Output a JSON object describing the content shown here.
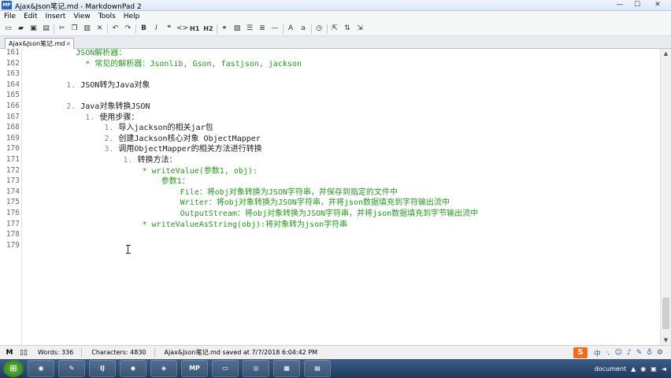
{
  "window": {
    "title": "Ajax&Json笔记.md - MarkdownPad 2",
    "app_icon_text": "MP",
    "minimize": "—",
    "maximize": "☐",
    "close": "✕"
  },
  "menu": [
    "File",
    "Edit",
    "Insert",
    "View",
    "Tools",
    "Help"
  ],
  "toolbar": {
    "h1_label": "H1",
    "h2_label": "H2"
  },
  "tab": {
    "label": "Ajax&Json笔记.md",
    "close": "×"
  },
  "editor": {
    "line_numbers": [
      "161",
      "162",
      "163",
      "164",
      "165",
      "166",
      "167",
      "168",
      "169",
      "170",
      "171",
      "172",
      "173",
      "174",
      "175",
      "176",
      "177",
      "178",
      "179"
    ],
    "lines": [
      {
        "ln": "161",
        "indent": "          ",
        "text": "JSON解析器：",
        "cls": "g"
      },
      {
        "ln": "162",
        "indent": "            ",
        "text": "* 常见的解析器：Jsonlib, Gson, fastjson, jackson",
        "cls": "g"
      },
      {
        "ln": "163",
        "indent": "",
        "text": "",
        "cls": "k"
      },
      {
        "ln": "164",
        "indent": "        ",
        "num": "1.",
        "text": " JSON转为Java对象",
        "cls": "k"
      },
      {
        "ln": "165",
        "indent": "",
        "text": "",
        "cls": "k"
      },
      {
        "ln": "166",
        "indent": "        ",
        "num": "2.",
        "text": " Java对象转换JSON",
        "cls": "k"
      },
      {
        "ln": "167",
        "indent": "            ",
        "num": "1.",
        "text": " 使用步骤：",
        "cls": "k"
      },
      {
        "ln": "168",
        "indent": "                ",
        "num": "1.",
        "text": " 导入jackson的相关jar包",
        "cls": "k"
      },
      {
        "ln": "169",
        "indent": "                ",
        "num": "2.",
        "text": " 创建Jackson核心对象 ObjectMapper",
        "cls": "k"
      },
      {
        "ln": "170",
        "indent": "                ",
        "num": "3.",
        "text": " 调用ObjectMapper的相关方法进行转换",
        "cls": "k"
      },
      {
        "ln": "171",
        "indent": "                    ",
        "num": "1.",
        "text": " 转换方法：",
        "cls": "k"
      },
      {
        "ln": "172",
        "indent": "                        ",
        "text": "* writeValue(参数1, obj):",
        "cls": "g"
      },
      {
        "ln": "173",
        "indent": "                            ",
        "text": "参数1：",
        "cls": "g"
      },
      {
        "ln": "174",
        "indent": "                                ",
        "text": "File：将obj对象转换为JSON字符串，并保存到指定的文件中",
        "cls": "g"
      },
      {
        "ln": "175",
        "indent": "                                ",
        "text": "Writer：将obj对象转换为JSON字符串，并将json数据填充到字符输出流中",
        "cls": "g"
      },
      {
        "ln": "176",
        "indent": "                                ",
        "text": "OutputStream：将obj对象转换为JSON字符串，并将json数据填充到字节输出流中",
        "cls": "g"
      },
      {
        "ln": "177",
        "indent": "                        ",
        "text": "* writeValueAsString(obj):将对象转为json字符串",
        "cls": "g"
      },
      {
        "ln": "178",
        "indent": "",
        "text": "",
        "cls": "k"
      },
      {
        "ln": "179",
        "indent": "",
        "text": "",
        "cls": "k"
      }
    ]
  },
  "status": {
    "mode_icon": "M",
    "words": "Words: 336",
    "characters": "Characters: 4830",
    "saved": "Ajax&Json笔记.md saved at 7/7/2018 6:04:42 PM"
  },
  "ime": {
    "logo": "S",
    "lang": "中"
  },
  "taskbar": {
    "apps": [
      "IJ",
      "MP"
    ],
    "tray_text": "document"
  }
}
